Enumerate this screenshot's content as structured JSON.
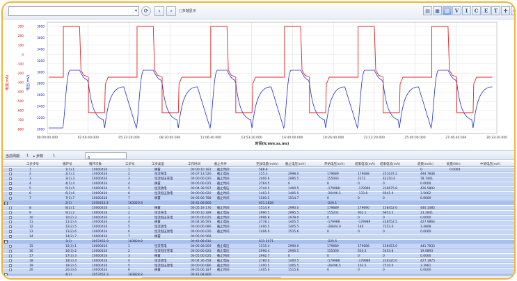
{
  "toolbar": {
    "select_value": "",
    "check_label": "□多轴显示",
    "icons": [
      "refresh-icon",
      "back-icon",
      "forward-icon"
    ],
    "right_icons": [
      {
        "name": "print-icon",
        "glyph": "▤"
      },
      {
        "name": "table-icon",
        "glyph": "▦"
      },
      {
        "name": "chart-icon",
        "glyph": "▥"
      },
      {
        "name": "v-icon",
        "glyph": "V"
      },
      {
        "name": "i-icon",
        "glyph": "I"
      },
      {
        "name": "c-icon",
        "glyph": "C"
      },
      {
        "name": "e-icon",
        "glyph": "E"
      },
      {
        "name": "t-icon",
        "glyph": "T"
      },
      {
        "name": "crosshair-icon",
        "glyph": "✛"
      },
      {
        "name": "grid-icon",
        "glyph": "✣"
      },
      {
        "name": "close-icon",
        "glyph": "▣"
      }
    ]
  },
  "chart_data": {
    "type": "line",
    "xlabel": "时间(h:mm:ss.ms)",
    "ylabel_left": "电压(mV)",
    "ylabel_right": "电流(mA)",
    "x_ticks": [
      "00:00:00.000",
      "02:46:40.000",
      "05:33:20.000",
      "08:20:00.000",
      "11:06:40.000",
      "13:53:20.000",
      "16:40:00.000",
      "19:26:40.000",
      "22:13:20.000",
      "25:00:00.000",
      "27:46:40.000",
      "30:33:20.000"
    ],
    "y_ticks_current": [
      "300",
      "200",
      "100",
      "0",
      "-100",
      "-200",
      "-300",
      "-400",
      "-500",
      "-600",
      "-700",
      "-800"
    ],
    "y_ticks_voltage": [
      "3800",
      "3600",
      "3400",
      "3200",
      "3000",
      "2800",
      "2600",
      "2400",
      "2200",
      "2000"
    ],
    "grid": true,
    "colors": {
      "current": "#e02020",
      "voltage": "#1c2ad8"
    },
    "cycles": 6
  },
  "subbar": {
    "label1": "当前周期",
    "label2": "1",
    "label3": "▸ 步数",
    "label4": "1",
    "input_value": "6"
  },
  "table": {
    "headers": [
      "工步步号",
      "循环号",
      "循环次数",
      "工步号",
      "工步类型",
      "工作时间",
      "截止条件",
      "充放电量(mAh)",
      "截止电压(mV)",
      "开始电压(mV)",
      "结束电流(mA)",
      "结束电流(mA)",
      "容量(mAh)",
      "能量(Wh)",
      "中值电压(mV)"
    ],
    "rows": [
      {
        "kind": "step",
        "c": [
          "1",
          "1(1).1",
          "10000416",
          "1",
          "搁置",
          "00:00:10.181",
          "截止时间",
          "588.8",
          "",
          "",
          "",
          "",
          "0",
          "0.0004",
          ""
        ]
      },
      {
        "kind": "step",
        "c": [
          "2",
          "2(1).2",
          "10000416",
          "2",
          "恒流充电",
          "00:07:13.520",
          "截止电压",
          "155.3",
          "2998.0",
          "179689",
          "179688",
          "251037.2",
          "494.7848",
          ""
        ]
      },
      {
        "kind": "step",
        "c": [
          "3",
          "3(1).3",
          "10000416",
          "3",
          "恒流恒压充电",
          "00:00:00.020",
          "截止时间",
          "2000.6",
          "2995.5",
          "155093",
          "2172",
          "42310.0",
          "78.7401",
          ""
        ]
      },
      {
        "kind": "step",
        "c": [
          "4",
          "4(1).4",
          "10000416",
          "4",
          "搁置",
          "00:05:00.025",
          "截止时间",
          "2764.5",
          "0",
          "0",
          "0",
          "0",
          "0.0000",
          ""
        ]
      },
      {
        "kind": "step",
        "c": [
          "5",
          "5(1).5",
          "10000416",
          "5",
          "恒流放电",
          "00:04:38.597",
          "截止电压",
          "2744.5",
          "1400.5",
          "-179988",
          "-179989",
          "230675.8",
          "426.5892",
          ""
        ]
      },
      {
        "kind": "step",
        "c": [
          "6",
          "6(1).6",
          "10000416",
          "6",
          "恒流恒压放电",
          "00:00:00.020",
          "截止时间",
          "1403.5",
          "1405.5",
          "-26496.5",
          "-133.8",
          "6641.0",
          "3.5662",
          ""
        ]
      },
      {
        "kind": "step",
        "c": [
          "7",
          "7(1).7",
          "10000416",
          "7",
          "搁置",
          "00:05:00.788",
          "截止时间",
          "1500.5",
          "1514.7",
          "0",
          "0",
          "0",
          "0.0000",
          ""
        ]
      },
      {
        "kind": "cycle",
        "c": [
          "",
          "2(1)",
          "2050413.4",
          "163020.8",
          "",
          "00:41:08.800",
          "",
          "631.1828",
          "",
          "-226.1",
          "",
          "",
          "",
          "",
          ""
        ]
      },
      {
        "kind": "step",
        "c": [
          "8",
          "8(2).1",
          "10000416",
          "1",
          "搁置",
          "00:05:19.176",
          "截止时间",
          "1514.9",
          "2990.0",
          "179689",
          "179690",
          "158452.0",
          "440.1085",
          ""
        ]
      },
      {
        "kind": "step",
        "c": [
          "9",
          "9(2).2",
          "10000416",
          "2",
          "恒流充电",
          "00:00:10.189",
          "截止电压",
          "2990.5",
          "2995.5",
          "155202",
          "902.1",
          "6953.5",
          "23.2841",
          ""
        ]
      },
      {
        "kind": "step",
        "c": [
          "10",
          "10(2).3",
          "10000416",
          "3",
          "恒流恒压充电",
          "00:05:00.025",
          "截止时间",
          "2996.8",
          "2978.0",
          "0",
          "0",
          "0",
          "0.0000",
          ""
        ]
      },
      {
        "kind": "step",
        "c": [
          "11",
          "11(2).4",
          "10000416",
          "4",
          "搁置",
          "00:04:36.591",
          "截止电压",
          "2778.1",
          "1405.5",
          "-179988",
          "-179989",
          "228552.5",
          "427.9864",
          ""
        ]
      },
      {
        "kind": "step",
        "c": [
          "12",
          "12(2).5",
          "10000416",
          "5",
          "恒流放电",
          "00:00:00.086",
          "截止时间",
          "1400.5",
          "1405.5",
          "-26604.0",
          "140",
          "7253.0",
          "3.4808",
          ""
        ]
      },
      {
        "kind": "step",
        "c": [
          "13",
          "13(2).6",
          "10000416",
          "6",
          "恒流恒压放电",
          "00:00:00.020",
          "截止时间",
          "1406.0",
          "1515.6",
          "0",
          "0",
          "0",
          "0.0000",
          ""
        ]
      },
      {
        "kind": "step",
        "c": [
          "14",
          "14(2).7",
          "10000416",
          "7",
          "搁置",
          "00:05:00.568",
          "",
          "",
          "",
          "",
          "",
          "",
          "",
          ""
        ]
      },
      {
        "kind": "cycle",
        "c": [
          "",
          "3(1)",
          "2057452.9",
          "183828.8",
          "",
          "00:41:08.810",
          "",
          "631.2071",
          "",
          "-225.5",
          "",
          "",
          "",
          "",
          ""
        ]
      },
      {
        "kind": "step",
        "c": [
          "15",
          "15(3).1",
          "10000416",
          "1",
          "恒流充电",
          "00:05:08.509",
          "截止电压",
          "1515.4",
          "2990.0",
          "179689",
          "179688",
          "158453.0",
          "441.7833",
          ""
        ]
      },
      {
        "kind": "step",
        "c": [
          "16",
          "16(3).2",
          "10000416",
          "2",
          "恒流恒压充电",
          "00:00:00.020",
          "截止电压",
          "2990.4",
          "2995.5",
          "155300",
          "630.2",
          "5454.8",
          "19.0893",
          ""
        ]
      },
      {
        "kind": "step",
        "c": [
          "17",
          "17(3).3",
          "10000416",
          "3",
          "搁置",
          "00:05:00.025",
          "截止时间",
          "2992.7",
          "0",
          "0",
          "0",
          "0",
          "0.0000",
          ""
        ]
      },
      {
        "kind": "step",
        "c": [
          "18",
          "18(3).4",
          "10000416",
          "4",
          "恒流放电",
          "00:04:36.458",
          "截止电压",
          "2780.0",
          "1400.5",
          "-179988",
          "-179989",
          "226320.0",
          "427.1875",
          ""
        ]
      },
      {
        "kind": "step",
        "c": [
          "19",
          "19(3).5",
          "10000416",
          "5",
          "恒流恒压放电",
          "00:00:00.086",
          "截止时间",
          "1400.5",
          "1405.5",
          "-26496.5",
          "103.5",
          "7510.0",
          "3.3961",
          ""
        ]
      },
      {
        "kind": "step",
        "c": [
          "20",
          "20(3).6",
          "10000416",
          "6",
          "搁置",
          "00:05:00.187",
          "截止时间",
          "1405.0",
          "1515.6",
          "0",
          "0",
          "0",
          "0.0000",
          ""
        ]
      },
      {
        "kind": "cycle",
        "c": [
          "",
          "4(1)",
          "2057452.3",
          "183828.8",
          "",
          "00:41:08.806",
          "",
          "",
          "",
          "",
          "",
          "",
          "",
          "",
          ""
        ]
      }
    ]
  }
}
